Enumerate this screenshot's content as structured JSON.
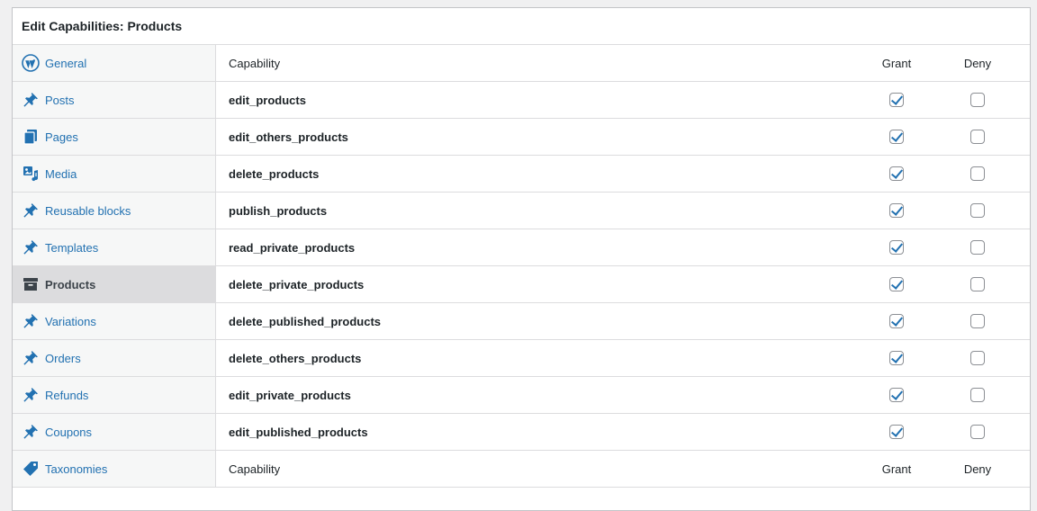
{
  "panel": {
    "title": "Edit Capabilities: Products"
  },
  "sidebar": {
    "items": [
      {
        "label": "General",
        "icon": "wordpress-icon"
      },
      {
        "label": "Posts",
        "icon": "pin-icon"
      },
      {
        "label": "Pages",
        "icon": "pages-icon"
      },
      {
        "label": "Media",
        "icon": "media-icon"
      },
      {
        "label": "Reusable blocks",
        "icon": "pin-icon"
      },
      {
        "label": "Templates",
        "icon": "pin-icon"
      },
      {
        "label": "Products",
        "icon": "archive-icon",
        "active": true
      },
      {
        "label": "Variations",
        "icon": "pin-icon"
      },
      {
        "label": "Orders",
        "icon": "pin-icon"
      },
      {
        "label": "Refunds",
        "icon": "pin-icon"
      },
      {
        "label": "Coupons",
        "icon": "pin-icon"
      },
      {
        "label": "Taxonomies",
        "icon": "tag-icon"
      }
    ]
  },
  "table": {
    "header": {
      "capability": "Capability",
      "grant": "Grant",
      "deny": "Deny"
    },
    "rows": [
      {
        "name": "edit_products",
        "grant": true,
        "deny": false
      },
      {
        "name": "edit_others_products",
        "grant": true,
        "deny": false
      },
      {
        "name": "delete_products",
        "grant": true,
        "deny": false
      },
      {
        "name": "publish_products",
        "grant": true,
        "deny": false
      },
      {
        "name": "read_private_products",
        "grant": true,
        "deny": false
      },
      {
        "name": "delete_private_products",
        "grant": true,
        "deny": false
      },
      {
        "name": "delete_published_products",
        "grant": true,
        "deny": false
      },
      {
        "name": "delete_others_products",
        "grant": true,
        "deny": false
      },
      {
        "name": "edit_private_products",
        "grant": true,
        "deny": false
      },
      {
        "name": "edit_published_products",
        "grant": true,
        "deny": false
      }
    ],
    "footer": {
      "capability": "Capability",
      "grant": "Grant",
      "deny": "Deny"
    }
  },
  "colors": {
    "link": "#2271b1",
    "active_bg": "#dcdcde",
    "border": "#dcdcde"
  }
}
